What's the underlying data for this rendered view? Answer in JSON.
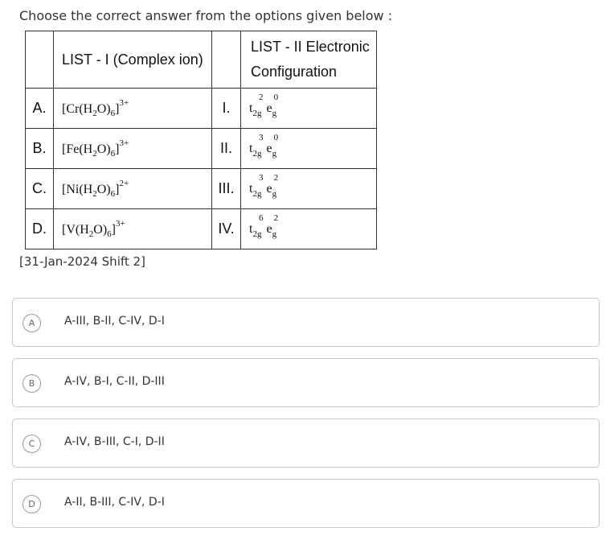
{
  "question": "Choose the correct answer from the options given below :",
  "table": {
    "header_list1": "LIST - I (Complex ion)",
    "header_list2_line1": "LIST - II Electronic",
    "header_list2_line2": "Configuration",
    "rows": [
      {
        "letter": "A.",
        "ion_metal": "[Cr(H",
        "ion_sub1": "2",
        "ion_mid": "O)",
        "ion_sub2": "6",
        "ion_close": "]",
        "ion_charge": "3+",
        "roman": "I.",
        "t2g_exp": "2",
        "eg_exp": "0"
      },
      {
        "letter": "B.",
        "ion_metal": "[Fe(H",
        "ion_sub1": "2",
        "ion_mid": "O)",
        "ion_sub2": "6",
        "ion_close": "]",
        "ion_charge": "3+",
        "roman": "II.",
        "t2g_exp": "3",
        "eg_exp": "0"
      },
      {
        "letter": "C.",
        "ion_metal": "[Ni(H",
        "ion_sub1": "2",
        "ion_mid": "O)",
        "ion_sub2": "6",
        "ion_close": "]",
        "ion_charge": "2+",
        "roman": "III.",
        "t2g_exp": "3",
        "eg_exp": "2"
      },
      {
        "letter": "D.",
        "ion_metal": "[V(H",
        "ion_sub1": "2",
        "ion_mid": "O)",
        "ion_sub2": "6",
        "ion_close": "]",
        "ion_charge": "3+",
        "roman": "IV.",
        "t2g_exp": "6",
        "eg_exp": "2"
      }
    ],
    "orbital_t": "t",
    "orbital_t_sub": "2g",
    "orbital_e": "e",
    "orbital_e_sub": "g"
  },
  "exam_tag": "[31-Jan-2024 Shift 2]",
  "options": [
    {
      "label": "A",
      "text": "A-III, B-II, C-IV, D-I"
    },
    {
      "label": "B",
      "text": "A-IV, B-I, C-II, D-III"
    },
    {
      "label": "C",
      "text": "A-IV, B-III, C-I, D-II"
    },
    {
      "label": "D",
      "text": "A-II, B-III, C-IV, D-I"
    }
  ]
}
